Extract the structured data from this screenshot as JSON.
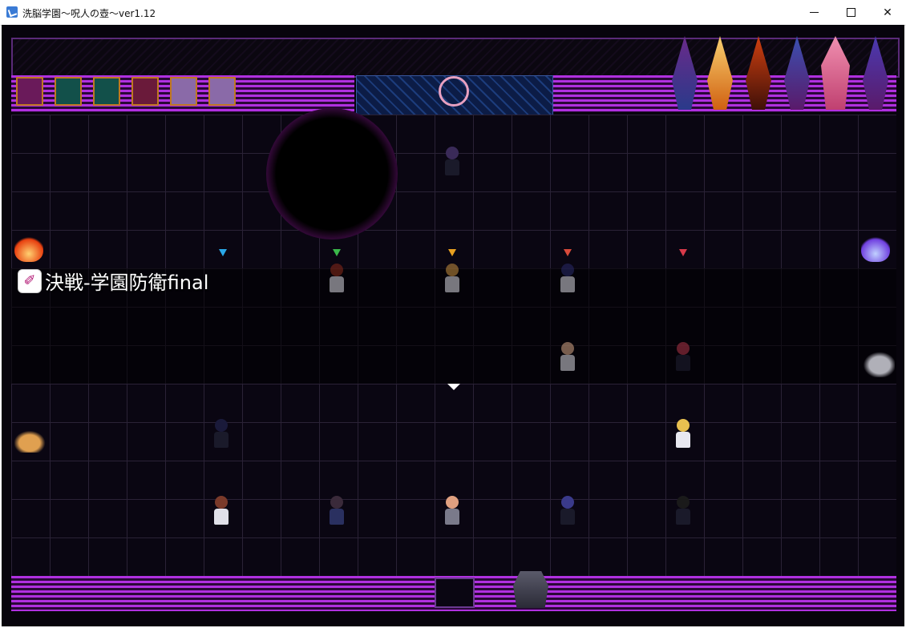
{
  "window": {
    "title": "洗脳学園～呪人の壺～ver1.12",
    "minimize_label": "minimize",
    "maximize_label": "maximize",
    "close_label": "close",
    "close_glyph": "✕"
  },
  "map_name": {
    "icon": "brainwash-pen-icon",
    "icon_glyph": "✐",
    "text": "決戦-学園防衛final"
  },
  "markers": [
    {
      "color": "#2aa8e8",
      "icon": "down-arrow-icon"
    },
    {
      "color": "#3ab84a",
      "icon": "down-arrow-icon"
    },
    {
      "color": "#e8a020",
      "icon": "down-arrow-icon"
    },
    {
      "color": "#d84a3a",
      "icon": "down-arrow-icon"
    },
    {
      "color": "#d83a4a",
      "icon": "down-arrow-icon"
    }
  ],
  "characters": [
    {
      "name": "purple-haired-student",
      "hair": "#3a2a58",
      "outfit": "#1a1a2a"
    },
    {
      "name": "red-haired-student",
      "hair": "#8a2a1a",
      "outfit": "#d8d8e0"
    },
    {
      "name": "blond-student",
      "hair": "#c89040",
      "outfit": "#d8d8e0"
    },
    {
      "name": "navy-haired-student",
      "hair": "#2a2a6a",
      "outfit": "#d8d8e0"
    },
    {
      "name": "bald-student",
      "hair": "#d8a888",
      "outfit": "#d8d8e0"
    },
    {
      "name": "maroon-haired-girl",
      "hair": "#8a2a3a",
      "outfit": "#1a1a2a"
    },
    {
      "name": "glasses-student",
      "hair": "#1a1a3a",
      "outfit": "#1a1a2a"
    },
    {
      "name": "blonde-girl",
      "hair": "#e8c050",
      "outfit": "#e8e8f0"
    },
    {
      "name": "brown-haired-student",
      "hair": "#7a3a2a",
      "outfit": "#e0e0e8"
    },
    {
      "name": "dark-haired-student",
      "hair": "#3a2a3a",
      "outfit": "#2a3060"
    },
    {
      "name": "bald-teacher",
      "hair": "#e0a080",
      "outfit": "#7a7a8a"
    },
    {
      "name": "blue-haired-girl",
      "hair": "#3a3a8a",
      "outfit": "#1a1a2a"
    },
    {
      "name": "black-haired-girl",
      "hair": "#1a1a1a",
      "outfit": "#1a1a2a"
    }
  ]
}
